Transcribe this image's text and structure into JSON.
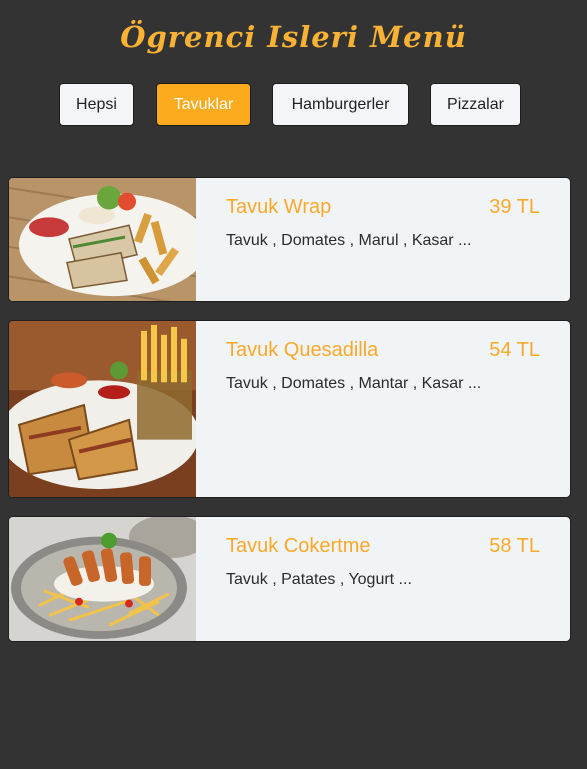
{
  "header": {
    "title": "Ögrenci Isleri Menü"
  },
  "filters": [
    {
      "label": "Hepsi",
      "active": false
    },
    {
      "label": "Tavuklar",
      "active": true
    },
    {
      "label": "Hamburgerler",
      "active": false
    },
    {
      "label": "Pizzalar",
      "active": false
    }
  ],
  "menu": {
    "items": [
      {
        "name": "Tavuk Wrap",
        "price": "39 TL",
        "description": "Tavuk , Domates , Marul , Kasar ..."
      },
      {
        "name": "Tavuk Quesadilla",
        "price": "54 TL",
        "description": "Tavuk , Domates , Mantar , Kasar ..."
      },
      {
        "name": "Tavuk Cokertme",
        "price": "58 TL",
        "description": "Tavuk , Patates , Yogurt ..."
      }
    ]
  },
  "colors": {
    "background": "#333334",
    "accent": "#fbab1d",
    "card": "#f1f4f7"
  }
}
